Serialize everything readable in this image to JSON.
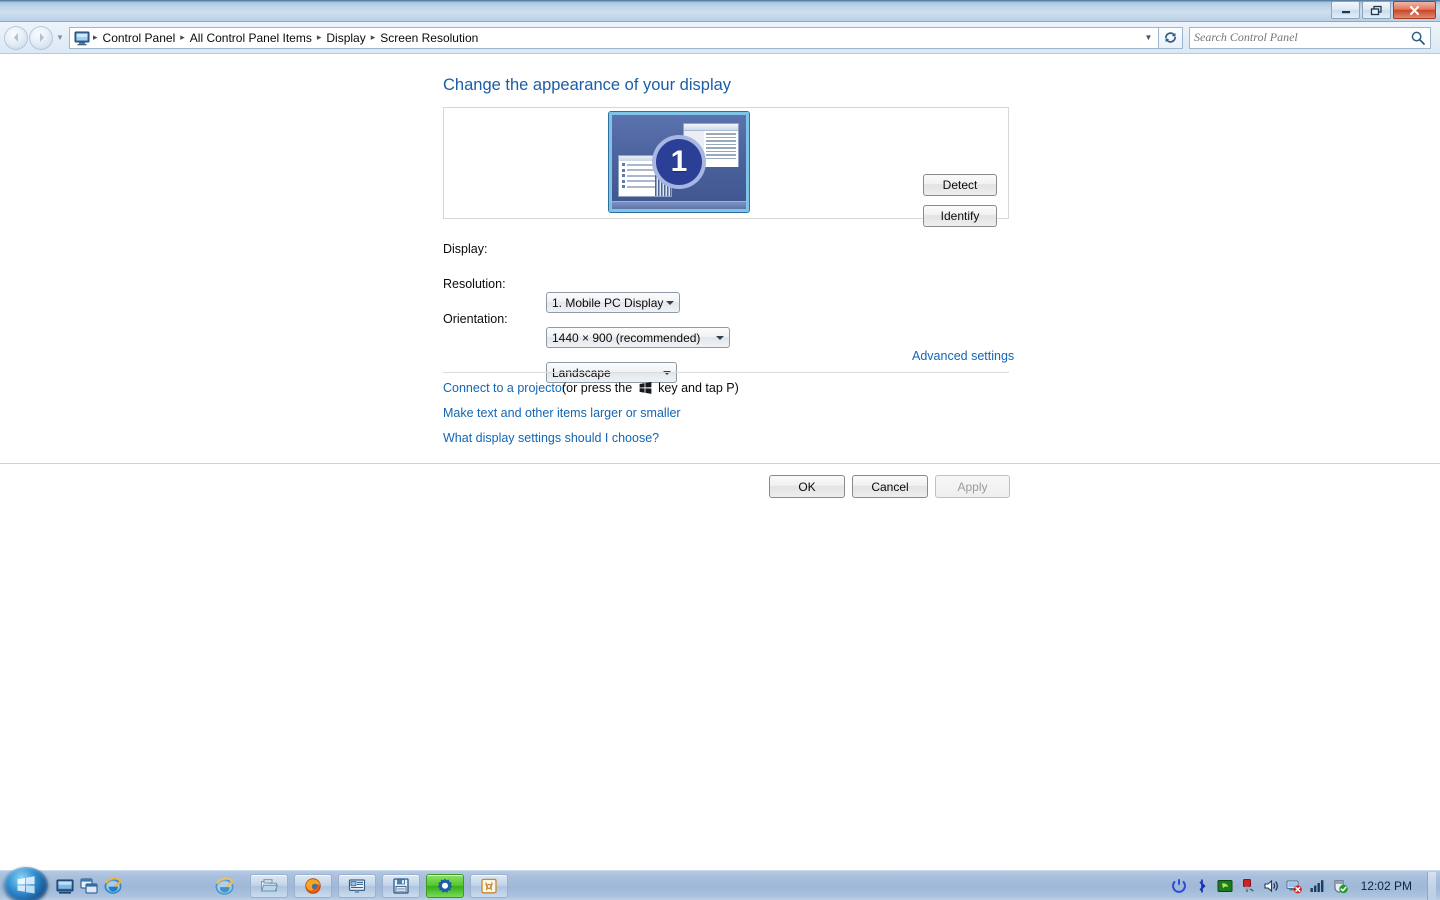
{
  "window": {
    "controls": {
      "minimize": "minimize-button",
      "maximize": "restore-button",
      "close": "close-button"
    }
  },
  "addressbar": {
    "back_tooltip": "Back",
    "forward_tooltip": "Forward",
    "breadcrumbs": [
      "Control Panel",
      "All Control Panel Items",
      "Display",
      "Screen Resolution"
    ],
    "separator": "▸",
    "refresh_icon": "refresh-icon",
    "dropdown_icon": "chevron-down-icon"
  },
  "search": {
    "placeholder": "Search Control Panel",
    "value": "",
    "icon": "search-icon"
  },
  "main": {
    "title": "Change the appearance of your display",
    "monitor": {
      "number": "1",
      "selected": true
    },
    "buttons": {
      "detect": "Detect",
      "identify": "Identify"
    },
    "fields": [
      {
        "label": "Display:",
        "value": "1. Mobile PC Display"
      },
      {
        "label": "Resolution:",
        "value": "1440 × 900 (recommended)"
      },
      {
        "label": "Orientation:",
        "value": "Landscape"
      }
    ],
    "advanced_link": "Advanced settings",
    "links": {
      "projector": "Connect to a projector",
      "projector_rest_pre": "(or press the",
      "projector_rest_post": "key and tap P)",
      "make_text": "Make text and other items larger or smaller",
      "what_settings": "What display settings should I choose?"
    }
  },
  "commandbar": {
    "ok": "OK",
    "cancel": "Cancel",
    "apply": "Apply",
    "apply_disabled": true
  },
  "taskbar": {
    "start": "start-orb",
    "quicklaunch": [
      {
        "name": "show-desktop-icon"
      },
      {
        "name": "switch-windows-icon"
      },
      {
        "name": "internet-explorer-icon"
      }
    ],
    "standalone_ie": "internet-explorer-icon",
    "tasks": [
      {
        "name": "windows-explorer-icon",
        "active": false
      },
      {
        "name": "firefox-icon",
        "active": false
      },
      {
        "name": "presentation-icon",
        "active": false
      },
      {
        "name": "save-disk-icon",
        "active": false
      },
      {
        "name": "control-panel-settings-icon",
        "active": true
      },
      {
        "name": "calendar-app-icon",
        "active": false
      }
    ],
    "tray": [
      {
        "name": "power-sync-icon"
      },
      {
        "name": "bluetooth-icon"
      },
      {
        "name": "nvidia-display-icon"
      },
      {
        "name": "safely-remove-hardware-icon"
      },
      {
        "name": "volume-icon"
      },
      {
        "name": "network-error-icon"
      },
      {
        "name": "signal-bars-icon"
      },
      {
        "name": "action-center-ok-icon"
      }
    ],
    "clock": "12:02 PM",
    "show_desktop": "show-desktop-strip"
  },
  "colors": {
    "accent_blue": "#1b5ea6",
    "link_blue": "#1266b5",
    "titlebar_blue": "#bcd3e9",
    "taskbar_blue": "#a9c0dd",
    "active_task_green": "#52c72e",
    "close_red": "#c9472a",
    "monitor_body": "#49609b",
    "monitor_selection": "#7ec3e8"
  }
}
